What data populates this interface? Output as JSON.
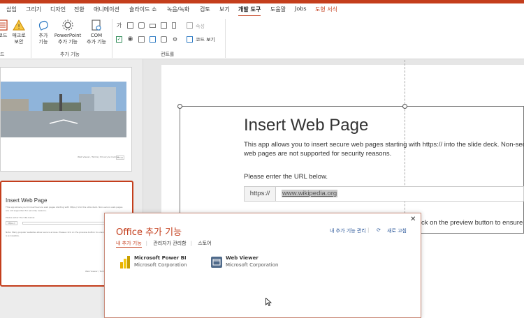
{
  "colors": {
    "accent": "#c43e1c",
    "link": "#2b579a"
  },
  "menu": {
    "tabs": [
      "삽입",
      "그리기",
      "디자인",
      "전환",
      "애니메이션",
      "슬라이드 쇼",
      "녹음/녹화",
      "검토",
      "보기",
      "개발 도구",
      "도움말",
      "Jobs",
      "도형 서식"
    ],
    "active": "개발 도구"
  },
  "ribbon": {
    "macro_label": "코드",
    "macro_security": "매크로\n보안",
    "code_group": "드",
    "addins": "추가\n기능",
    "ppt_addins": "PowerPoint\n추가 기능",
    "com_addins": "COM\n추가 기능",
    "addins_group": "추가 기능",
    "properties": "속성",
    "view_code": "코드 보기",
    "controls_group": "컨트롤",
    "text_glyph": "가"
  },
  "thumb1": {
    "caption1": "Web Viewer / Terms | Privacy & Cookies",
    "caption2": "Close"
  },
  "thumb2": {
    "title": "Insert Web Page",
    "line1": "This app allows you to insert secure web pages starting with https:// into the slide deck. Non-secure web pages",
    "line2": "are not supported for security reasons.",
    "line3": "Please enter the URL below.",
    "prefix": "https://",
    "line4": "Note: Many popular websites allow secure access. Please click on the preview button to ensure the web page",
    "line5": "is accessible.",
    "footer": "Web Viewer / Terms | Privacy & Cookies"
  },
  "slide": {
    "title": "Insert Web Page",
    "description": "This app allows you to insert secure web pages starting with https:// into the slide deck. Non-secure web pages are not supported for security reasons.",
    "prompt": "Please enter the URL below.",
    "prefix": "https://",
    "url": "www.wikipedia.org",
    "behind_text": "ck on the preview button to ensure the"
  },
  "dialog": {
    "title": "Office 추가 기능",
    "manage_link": "내 추가 기능 관리",
    "refresh_link": "새로 고침",
    "tabs": [
      "내 추가 기능",
      "관리자가 관리함",
      "스토어"
    ],
    "addins": [
      {
        "name": "Microsoft Power BI",
        "publisher": "Microsoft Corporation",
        "icon": "power-bi-icon"
      },
      {
        "name": "Web Viewer",
        "publisher": "Microsoft Corporation",
        "icon": "web-viewer-icon"
      }
    ]
  }
}
